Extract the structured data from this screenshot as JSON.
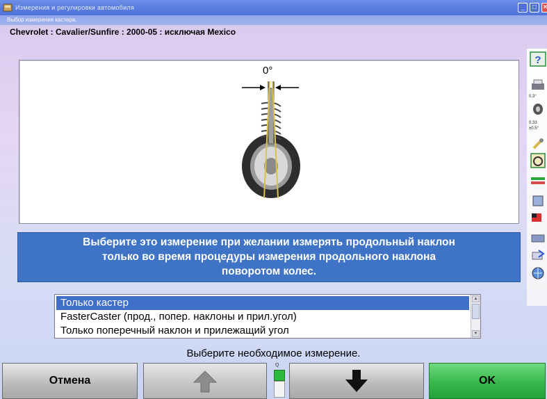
{
  "window": {
    "title": "Измерения и регулировки автомобиля",
    "subtitle": "Выбор измерения кастера."
  },
  "vehicle": {
    "line": "Chevrolet : Cavalier/Sunfire : 2000-05 : исключая Mexico"
  },
  "illustration": {
    "angle_label": "0°"
  },
  "info": {
    "line1": "Выберите это измерение при желании измерять продольный наклон",
    "line2": "только во время процедуры измерения продольного наклона",
    "line3": "поворотом колес."
  },
  "options": {
    "items": [
      "Только кастер",
      "FasterCaster (прод., попер. наклоны и прил.угол)",
      "Только поперечный наклон и прилежащий угол"
    ],
    "selected_index": 0
  },
  "prompt": "Выберите необходимое измерение.",
  "buttons": {
    "cancel": "Отмена",
    "ok": "OK"
  },
  "sidebar": {
    "readout1": "0.3°",
    "readout2": "0.33",
    "readout3": "±0.5°"
  },
  "colors": {
    "banner": "#3f73c6",
    "selection": "#3f6fc8",
    "ok": "#38b74b"
  }
}
